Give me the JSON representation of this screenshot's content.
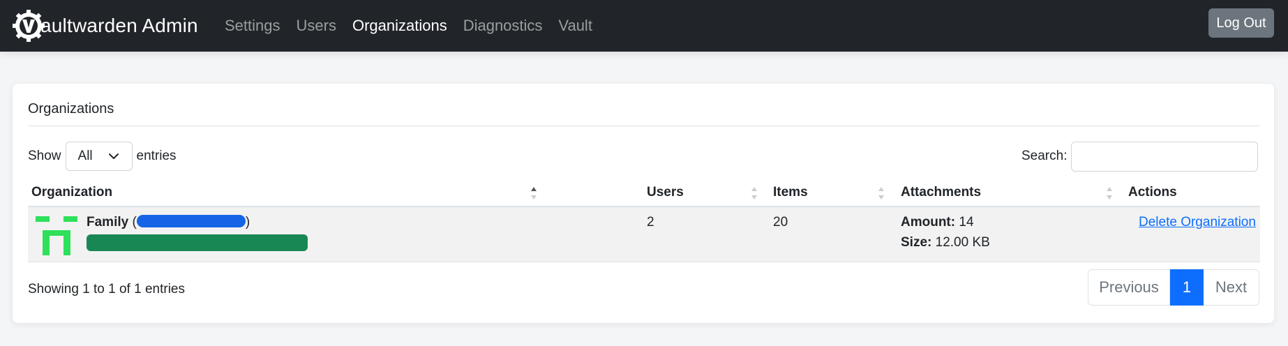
{
  "navbar": {
    "brand": "aultwarden Admin",
    "links": [
      "Settings",
      "Users",
      "Organizations",
      "Diagnostics",
      "Vault"
    ],
    "active": "Organizations",
    "logout_label": "Log Out"
  },
  "card": {
    "title": "Organizations",
    "length_menu": {
      "prefix": "Show",
      "selected": "All",
      "suffix": "entries"
    },
    "search_label": "Search:",
    "search_value": ""
  },
  "table": {
    "columns": [
      "Organization",
      "Users",
      "Items",
      "Attachments",
      "Actions"
    ],
    "rows": [
      {
        "name": "Family",
        "id_open": "(",
        "id_close": ")",
        "users": "2",
        "items": "20",
        "attachments_amount_label": "Amount:",
        "attachments_amount": "14",
        "attachments_size_label": "Size:",
        "attachments_size": "12.00 KB",
        "action": "Delete Organization"
      }
    ]
  },
  "footer": {
    "info": "Showing 1 to 1 of 1 entries",
    "prev": "Previous",
    "page": "1",
    "next": "Next"
  },
  "colors": {
    "navbar": "#212529",
    "accent": "#0d6efd",
    "org_bar": "#198754",
    "org_icon": "#2ee05a",
    "logout": "#6c757d"
  }
}
